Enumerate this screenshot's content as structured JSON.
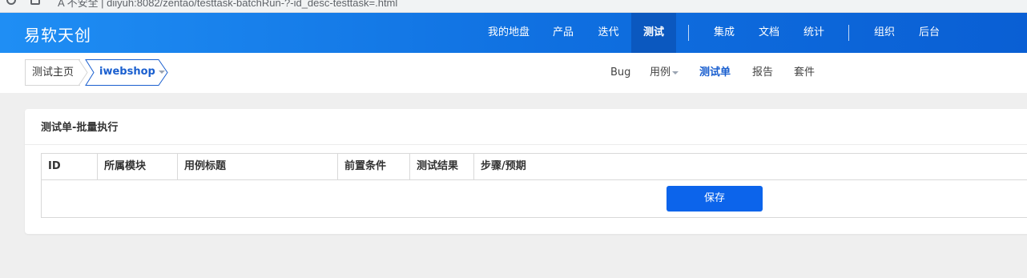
{
  "browser": {
    "url_text": "A 不安全 | diiyuh:8082/zentao/testtask-batchRun-?-id_desc-testtask=.html"
  },
  "brand": {
    "name": "易软天创"
  },
  "main_nav": {
    "items": [
      {
        "label": "我的地盘"
      },
      {
        "label": "产品"
      },
      {
        "label": "迭代"
      },
      {
        "label": "测试",
        "active": true
      },
      {
        "label": "集成"
      },
      {
        "label": "文档"
      },
      {
        "label": "统计"
      },
      {
        "label": "组织"
      },
      {
        "label": "后台"
      }
    ]
  },
  "breadcrumb": {
    "home": "测试主页",
    "product": "iwebshop"
  },
  "sub_nav": {
    "items": [
      {
        "label": "Bug"
      },
      {
        "label": "用例",
        "has_dropdown": true
      },
      {
        "label": "测试单",
        "active": true
      },
      {
        "label": "报告"
      },
      {
        "label": "套件"
      }
    ]
  },
  "panel": {
    "title": "测试单-批量执行",
    "table": {
      "columns": [
        "ID",
        "所属模块",
        "用例标题",
        "前置条件",
        "测试结果",
        "步骤/预期"
      ],
      "rows": []
    },
    "save_label": "保存"
  },
  "colors": {
    "topbar_start": "#1f8ef4",
    "topbar_end": "#0a5fd4",
    "active_tab": "#0b58bf",
    "accent": "#1a5fcf",
    "button": "#0c64eb",
    "background": "#efefef"
  }
}
